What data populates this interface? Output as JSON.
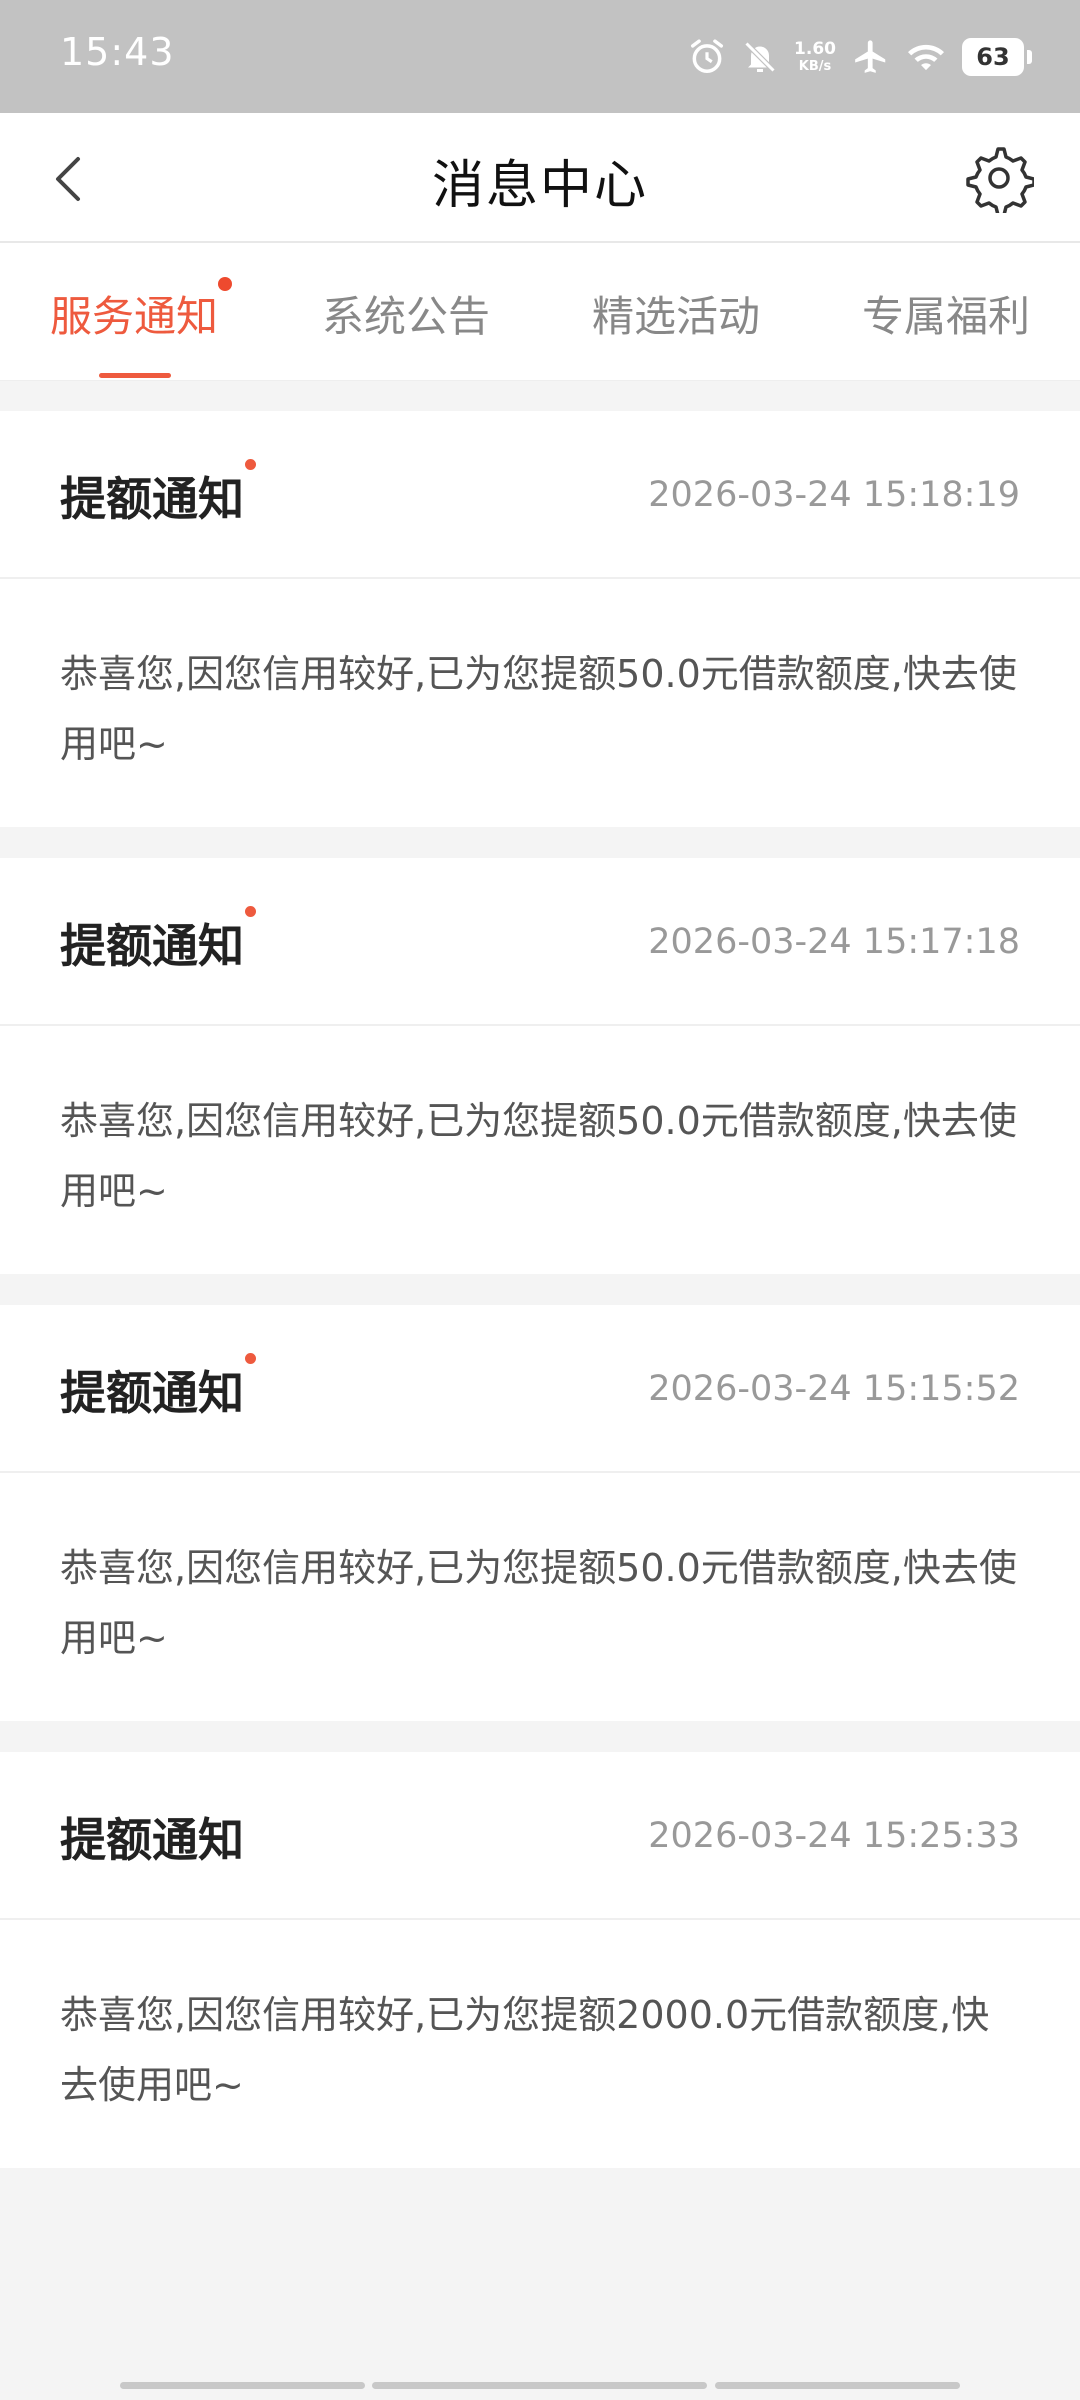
{
  "status_bar": {
    "time": "15:43",
    "net_speed_value": "1.60",
    "net_speed_unit": "KB/s",
    "battery": "63",
    "icons": [
      "alarm-icon",
      "mute-bell-icon",
      "airplane-icon",
      "wifi-icon"
    ]
  },
  "header": {
    "title": "消息中心",
    "icons": [
      "back-arrow-icon",
      "gear-icon"
    ]
  },
  "tabs": [
    {
      "label": "服务通知",
      "active": true,
      "unread": true
    },
    {
      "label": "系统公告",
      "active": false,
      "unread": false
    },
    {
      "label": "精选活动",
      "active": false,
      "unread": false
    },
    {
      "label": "专属福利",
      "active": false,
      "unread": false
    }
  ],
  "messages": [
    {
      "title": "提额通知",
      "time": "2026-03-24 15:18:19",
      "unread": true,
      "body": "恭喜您,因您信用较好,已为您提额50.0元借款额度,快去使用吧~"
    },
    {
      "title": "提额通知",
      "time": "2026-03-24 15:17:18",
      "unread": true,
      "body": "恭喜您,因您信用较好,已为您提额50.0元借款额度,快去使用吧~"
    },
    {
      "title": "提额通知",
      "time": "2026-03-24 15:15:52",
      "unread": true,
      "body": "恭喜您,因您信用较好,已为您提额50.0元借款额度,快去使用吧~"
    },
    {
      "title": "提额通知",
      "time": "2026-03-24 15:25:33",
      "unread": false,
      "body": "恭喜您,因您信用较好,已为您提额2000.0元借款额度,快去使用吧~"
    }
  ],
  "colors": {
    "accent": "#ee5a3e",
    "status_bar_bg": "#c2c2c2",
    "page_bg": "#f4f4f4"
  }
}
